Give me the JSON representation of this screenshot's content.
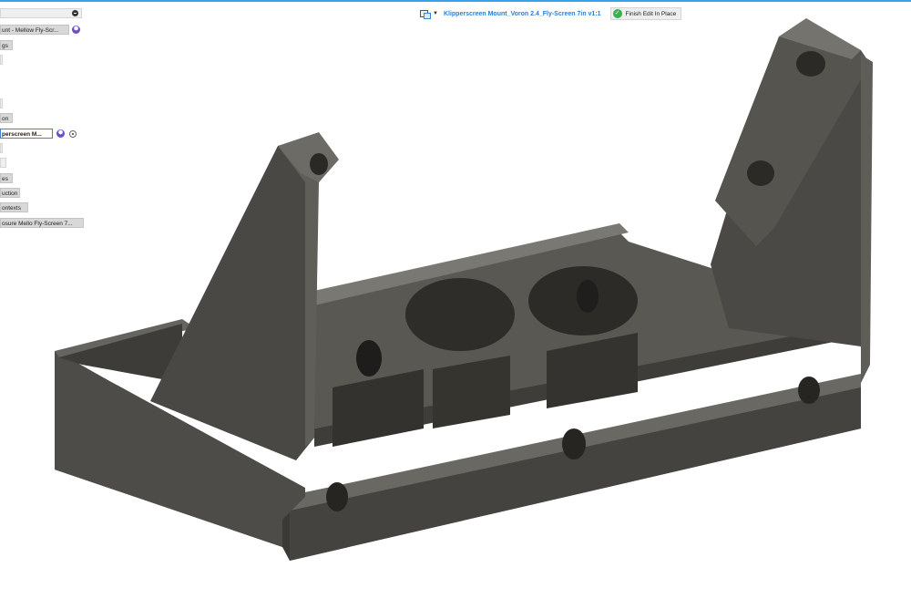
{
  "context_bar": {
    "title": "Klipperscreen Mount_Voron 2.4_Fly-Screen 7in v1:1",
    "finish_label": "Finish Edit In Place"
  },
  "browser": {
    "items": [
      {
        "label": ""
      },
      {
        "label": "unt - Mellow Fly-Scr..."
      },
      {
        "label": "gs"
      },
      {
        "label": ""
      },
      {
        "label": ""
      },
      {
        "label": "on"
      },
      {
        "label": "perscreen M..."
      },
      {
        "label": ""
      },
      {
        "label": ""
      },
      {
        "label": "es"
      },
      {
        "label": "uction"
      },
      {
        "label": "ontexts"
      },
      {
        "label": "osure Mello Fly-Screen 7..."
      }
    ]
  },
  "colors": {
    "accent": "#3aa0e8",
    "title_blue": "#2a7fd4",
    "success": "#37b24d",
    "model_gray": "#4a4844"
  }
}
